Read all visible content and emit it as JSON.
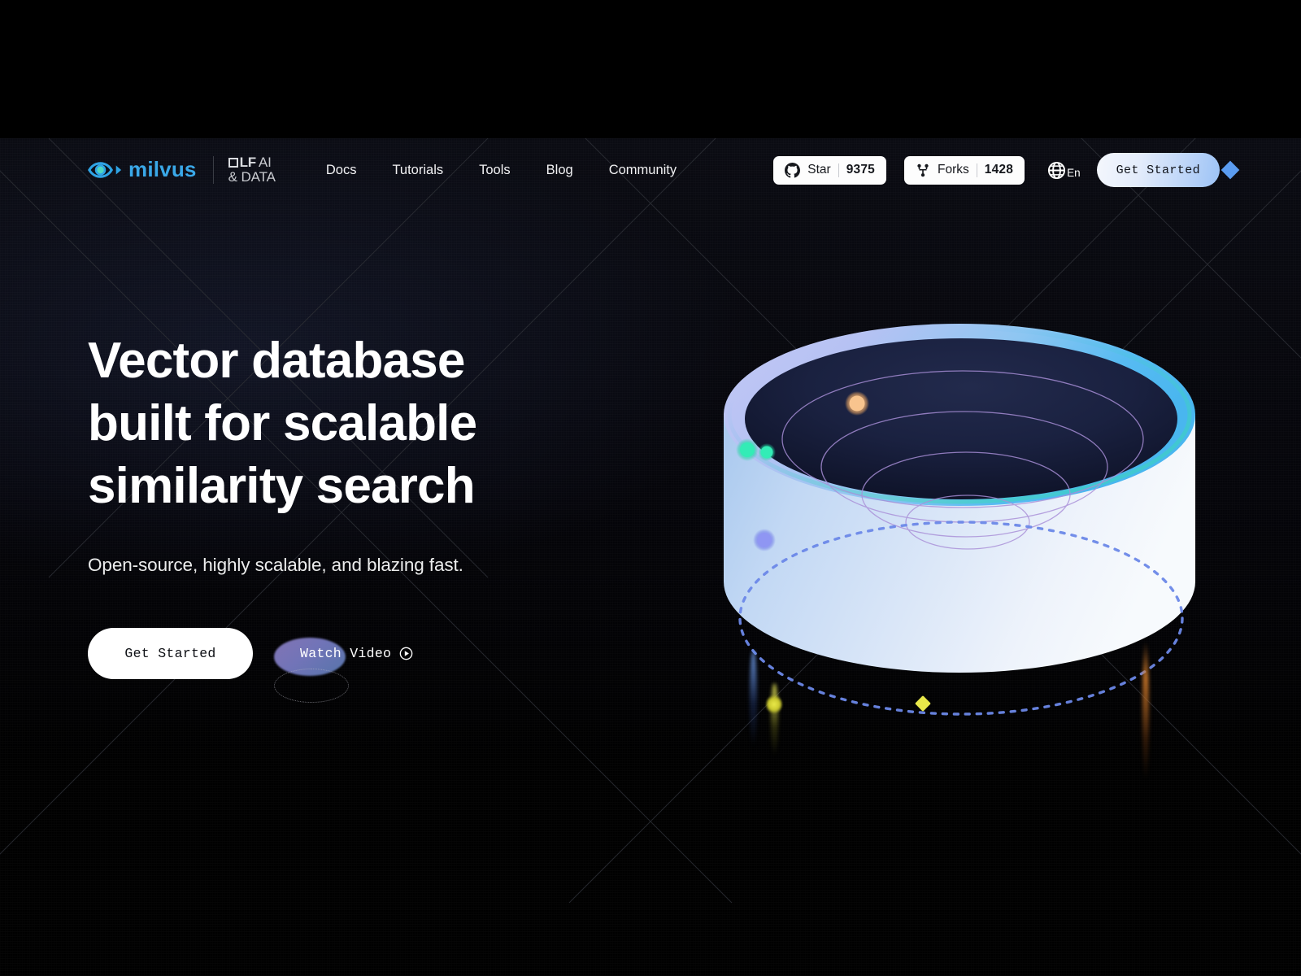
{
  "brand": {
    "logo_icon": "milvus-eye-logo-icon",
    "wordmark": "milvus",
    "lf_line1_mark": "□",
    "lf_line1_bold": "LF",
    "lf_line1_light": "AI",
    "lf_line2": "& DATA"
  },
  "nav": {
    "items": [
      {
        "label": "Docs"
      },
      {
        "label": "Tutorials"
      },
      {
        "label": "Tools"
      },
      {
        "label": "Blog"
      },
      {
        "label": "Community"
      }
    ]
  },
  "header_right": {
    "star": {
      "icon": "github-icon",
      "label": "Star",
      "count": "9375"
    },
    "forks": {
      "icon": "fork-icon",
      "label": "Forks",
      "count": "1428"
    },
    "language": {
      "icon": "globe-icon",
      "label": "En"
    },
    "get_started_label": "Get Started"
  },
  "hero": {
    "headline": "Vector database\nbuilt for scalable\nsimilarity search",
    "subtitle": "Open-source, highly scalable, and blazing fast.",
    "primary_cta": "Get Started",
    "secondary_cta": "Watch Video",
    "secondary_cta_icon": "play-circle-icon"
  },
  "illustration": {
    "name": "vector-database-bowl-illustration",
    "rim_color_left": "#b9c1f2",
    "rim_color_right": "#5ab9f0",
    "interior_color": "#161b33",
    "body_color": "#e8eef9",
    "ring_color": "#a98fd8",
    "orbit_color": "#5b7fe0",
    "marker_diamond_color": "#e8e84a",
    "dots": [
      {
        "name": "dot-orange",
        "color": "#f6bb80"
      },
      {
        "name": "dot-teal-large",
        "color": "#2fe9b4"
      },
      {
        "name": "dot-teal-small",
        "color": "#2fe9b4"
      },
      {
        "name": "dot-periwinkle",
        "color": "#8b93f0"
      }
    ]
  },
  "decor": {
    "nav_diamond_color": "#5b9cf0"
  }
}
